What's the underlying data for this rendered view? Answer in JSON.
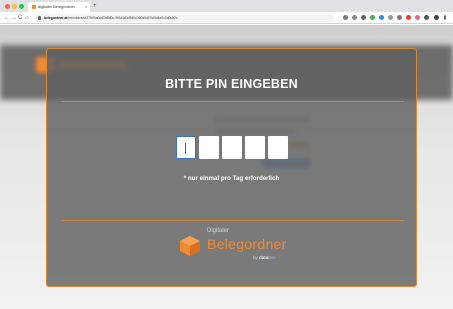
{
  "browser": {
    "tab_title": "digitaler Belegordner",
    "tab_close": "×",
    "new_tab": "+",
    "url_host": "belegordner.at",
    "url_path": "/members/ot27590a0cd0b8d0c-9f5d4d0d9d0c060d0d09d0d4e0c0d0cb2c",
    "nav": {
      "back": "←",
      "forward": "→",
      "reload": "C",
      "home": "⌂"
    },
    "colors": {
      "tab_accent": "#f28b30"
    }
  },
  "modal": {
    "title": "BITTE PIN EINGEBEN",
    "pin_boxes": 5,
    "note": "* nur einmal pro Tag erforderlich"
  },
  "brand": {
    "small": "Digitaler",
    "large": "Belegordner",
    "by_prefix": "by",
    "by_bold": "data",
    "by_light": "box",
    "colors": {
      "orange": "#f28b30"
    }
  }
}
